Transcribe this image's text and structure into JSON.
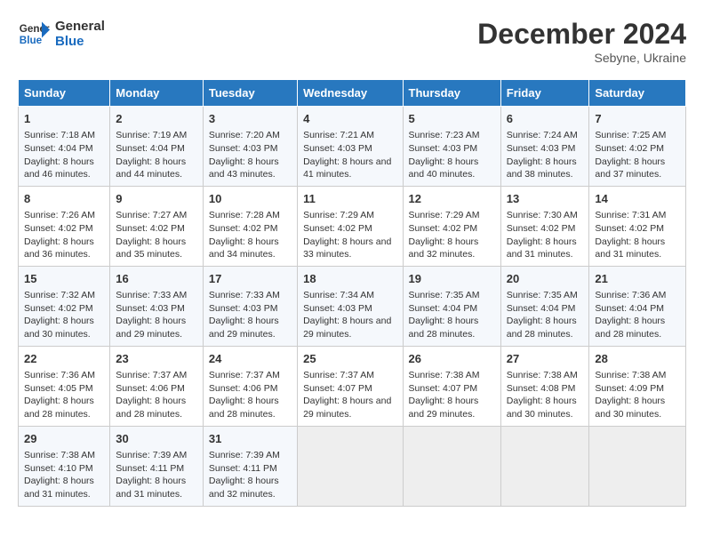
{
  "header": {
    "logo_line1": "General",
    "logo_line2": "Blue",
    "month": "December 2024",
    "location": "Sebyne, Ukraine"
  },
  "days_of_week": [
    "Sunday",
    "Monday",
    "Tuesday",
    "Wednesday",
    "Thursday",
    "Friday",
    "Saturday"
  ],
  "weeks": [
    [
      {
        "day": 1,
        "info": "Sunrise: 7:18 AM\nSunset: 4:04 PM\nDaylight: 8 hours and 46 minutes."
      },
      {
        "day": 2,
        "info": "Sunrise: 7:19 AM\nSunset: 4:04 PM\nDaylight: 8 hours and 44 minutes."
      },
      {
        "day": 3,
        "info": "Sunrise: 7:20 AM\nSunset: 4:03 PM\nDaylight: 8 hours and 43 minutes."
      },
      {
        "day": 4,
        "info": "Sunrise: 7:21 AM\nSunset: 4:03 PM\nDaylight: 8 hours and 41 minutes."
      },
      {
        "day": 5,
        "info": "Sunrise: 7:23 AM\nSunset: 4:03 PM\nDaylight: 8 hours and 40 minutes."
      },
      {
        "day": 6,
        "info": "Sunrise: 7:24 AM\nSunset: 4:03 PM\nDaylight: 8 hours and 38 minutes."
      },
      {
        "day": 7,
        "info": "Sunrise: 7:25 AM\nSunset: 4:02 PM\nDaylight: 8 hours and 37 minutes."
      }
    ],
    [
      {
        "day": 8,
        "info": "Sunrise: 7:26 AM\nSunset: 4:02 PM\nDaylight: 8 hours and 36 minutes."
      },
      {
        "day": 9,
        "info": "Sunrise: 7:27 AM\nSunset: 4:02 PM\nDaylight: 8 hours and 35 minutes."
      },
      {
        "day": 10,
        "info": "Sunrise: 7:28 AM\nSunset: 4:02 PM\nDaylight: 8 hours and 34 minutes."
      },
      {
        "day": 11,
        "info": "Sunrise: 7:29 AM\nSunset: 4:02 PM\nDaylight: 8 hours and 33 minutes."
      },
      {
        "day": 12,
        "info": "Sunrise: 7:29 AM\nSunset: 4:02 PM\nDaylight: 8 hours and 32 minutes."
      },
      {
        "day": 13,
        "info": "Sunrise: 7:30 AM\nSunset: 4:02 PM\nDaylight: 8 hours and 31 minutes."
      },
      {
        "day": 14,
        "info": "Sunrise: 7:31 AM\nSunset: 4:02 PM\nDaylight: 8 hours and 31 minutes."
      }
    ],
    [
      {
        "day": 15,
        "info": "Sunrise: 7:32 AM\nSunset: 4:02 PM\nDaylight: 8 hours and 30 minutes."
      },
      {
        "day": 16,
        "info": "Sunrise: 7:33 AM\nSunset: 4:03 PM\nDaylight: 8 hours and 29 minutes."
      },
      {
        "day": 17,
        "info": "Sunrise: 7:33 AM\nSunset: 4:03 PM\nDaylight: 8 hours and 29 minutes."
      },
      {
        "day": 18,
        "info": "Sunrise: 7:34 AM\nSunset: 4:03 PM\nDaylight: 8 hours and 29 minutes."
      },
      {
        "day": 19,
        "info": "Sunrise: 7:35 AM\nSunset: 4:04 PM\nDaylight: 8 hours and 28 minutes."
      },
      {
        "day": 20,
        "info": "Sunrise: 7:35 AM\nSunset: 4:04 PM\nDaylight: 8 hours and 28 minutes."
      },
      {
        "day": 21,
        "info": "Sunrise: 7:36 AM\nSunset: 4:04 PM\nDaylight: 8 hours and 28 minutes."
      }
    ],
    [
      {
        "day": 22,
        "info": "Sunrise: 7:36 AM\nSunset: 4:05 PM\nDaylight: 8 hours and 28 minutes."
      },
      {
        "day": 23,
        "info": "Sunrise: 7:37 AM\nSunset: 4:06 PM\nDaylight: 8 hours and 28 minutes."
      },
      {
        "day": 24,
        "info": "Sunrise: 7:37 AM\nSunset: 4:06 PM\nDaylight: 8 hours and 28 minutes."
      },
      {
        "day": 25,
        "info": "Sunrise: 7:37 AM\nSunset: 4:07 PM\nDaylight: 8 hours and 29 minutes."
      },
      {
        "day": 26,
        "info": "Sunrise: 7:38 AM\nSunset: 4:07 PM\nDaylight: 8 hours and 29 minutes."
      },
      {
        "day": 27,
        "info": "Sunrise: 7:38 AM\nSunset: 4:08 PM\nDaylight: 8 hours and 30 minutes."
      },
      {
        "day": 28,
        "info": "Sunrise: 7:38 AM\nSunset: 4:09 PM\nDaylight: 8 hours and 30 minutes."
      }
    ],
    [
      {
        "day": 29,
        "info": "Sunrise: 7:38 AM\nSunset: 4:10 PM\nDaylight: 8 hours and 31 minutes."
      },
      {
        "day": 30,
        "info": "Sunrise: 7:39 AM\nSunset: 4:11 PM\nDaylight: 8 hours and 31 minutes."
      },
      {
        "day": 31,
        "info": "Sunrise: 7:39 AM\nSunset: 4:11 PM\nDaylight: 8 hours and 32 minutes."
      },
      null,
      null,
      null,
      null
    ]
  ]
}
